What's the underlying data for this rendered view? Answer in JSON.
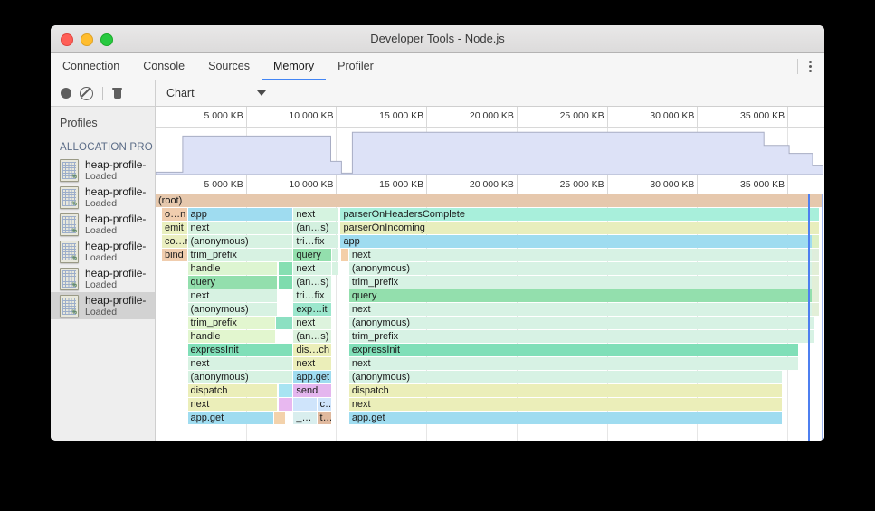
{
  "window": {
    "title": "Developer Tools - Node.js",
    "traffic_lights": [
      "close",
      "minimize",
      "maximize"
    ]
  },
  "tabs": [
    {
      "label": "Connection",
      "active": false
    },
    {
      "label": "Console",
      "active": false
    },
    {
      "label": "Sources",
      "active": false
    },
    {
      "label": "Memory",
      "active": true
    },
    {
      "label": "Profiler",
      "active": false
    }
  ],
  "tabbar": {
    "more_menu": "kebab-menu"
  },
  "toolbar": {
    "record_label": "record",
    "clear_label": "clear",
    "delete_label": "delete",
    "view_select_value": "Chart"
  },
  "sidebar": {
    "title": "Profiles",
    "group_label": "ALLOCATION PRO",
    "items": [
      {
        "name": "heap-profile-",
        "status": "Loaded",
        "selected": false
      },
      {
        "name": "heap-profile-",
        "status": "Loaded",
        "selected": false
      },
      {
        "name": "heap-profile-",
        "status": "Loaded",
        "selected": false
      },
      {
        "name": "heap-profile-",
        "status": "Loaded",
        "selected": false
      },
      {
        "name": "heap-profile-",
        "status": "Loaded",
        "selected": false
      },
      {
        "name": "heap-profile-",
        "status": "Loaded",
        "selected": true
      }
    ]
  },
  "chart_data": {
    "type": "area",
    "title": "",
    "xlabel": "",
    "ylabel": "",
    "tick_labels": [
      "5 000 KB",
      "10 000 KB",
      "15 000 KB",
      "20 000 KB",
      "25 000 KB",
      "30 000 KB",
      "35 000 KB"
    ],
    "tick_values": [
      5000,
      10000,
      15000,
      20000,
      25000,
      30000,
      35000
    ],
    "xlim": [
      0,
      37000
    ],
    "grid": true,
    "overview_series": [
      {
        "x": 0,
        "y": 5
      },
      {
        "x": 1500,
        "y": 5
      },
      {
        "x": 1500,
        "y": 82
      },
      {
        "x": 9700,
        "y": 82
      },
      {
        "x": 9700,
        "y": 28
      },
      {
        "x": 10300,
        "y": 28
      },
      {
        "x": 10300,
        "y": 3
      },
      {
        "x": 10900,
        "y": 3
      },
      {
        "x": 10900,
        "y": 90
      },
      {
        "x": 33700,
        "y": 90
      },
      {
        "x": 33700,
        "y": 62
      },
      {
        "x": 35100,
        "y": 62
      },
      {
        "x": 35100,
        "y": 45
      },
      {
        "x": 36400,
        "y": 45
      },
      {
        "x": 36400,
        "y": 20
      },
      {
        "x": 37000,
        "y": 20
      }
    ]
  },
  "flame_chart": {
    "frames": [
      {
        "label": "(root)",
        "depth": 0,
        "x0": 0,
        "x1": 37000,
        "color": "#e6c8ad"
      },
      {
        "label": "o…n",
        "depth": 1,
        "x0": 350,
        "x1": 1750,
        "color": "#f0cdae"
      },
      {
        "label": "app",
        "depth": 1,
        "x0": 1780,
        "x1": 7560,
        "color": "#9fdcf0"
      },
      {
        "label": "next",
        "depth": 1,
        "x0": 7640,
        "x1": 10100,
        "color": "#d5f3e0"
      },
      {
        "label": "parserOnHeadersComplete",
        "depth": 1,
        "x0": 10250,
        "x1": 36750,
        "color": "#a8efdb"
      },
      {
        "label": "emit",
        "depth": 2,
        "x0": 350,
        "x1": 1750,
        "color": "#eaf0bf"
      },
      {
        "label": "next",
        "depth": 2,
        "x0": 1780,
        "x1": 7560,
        "color": "#d7f2e0"
      },
      {
        "label": "(an…s)",
        "depth": 2,
        "x0": 7640,
        "x1": 10100,
        "color": "#d3f0df"
      },
      {
        "label": "parserOnIncoming",
        "depth": 2,
        "x0": 10250,
        "x1": 36750,
        "color": "#e8eebd"
      },
      {
        "label": "co…r",
        "depth": 3,
        "x0": 350,
        "x1": 1750,
        "color": "#eaeec0"
      },
      {
        "label": "(anonymous)",
        "depth": 3,
        "x0": 1780,
        "x1": 7560,
        "color": "#d7f2e2"
      },
      {
        "label": "tri…fix",
        "depth": 3,
        "x0": 7640,
        "x1": 10100,
        "color": "#d6f1e2"
      },
      {
        "label": "app",
        "depth": 3,
        "x0": 10250,
        "x1": 36600,
        "color": "#9fdcf0"
      },
      {
        "label": "bind",
        "depth": 4,
        "x0": 350,
        "x1": 1750,
        "color": "#f0cdae"
      },
      {
        "label": "trim_prefix",
        "depth": 4,
        "x0": 1780,
        "x1": 7560,
        "color": "#d7f2e2"
      },
      {
        "label": "query",
        "depth": 4,
        "x0": 7640,
        "x1": 9750,
        "color": "#93dfad"
      },
      {
        "label": "",
        "depth": 4,
        "x0": 9800,
        "x1": 10100,
        "color": "#d7f2e2"
      },
      {
        "label": "",
        "depth": 4,
        "x0": 10280,
        "x1": 10680,
        "color": "#f4cfa8"
      },
      {
        "label": "next",
        "depth": 4,
        "x0": 10720,
        "x1": 36500,
        "color": "#d7f2e4"
      },
      {
        "label": "handle",
        "depth": 5,
        "x0": 1780,
        "x1": 6700,
        "color": "#ddf5d1"
      },
      {
        "label": "",
        "depth": 5,
        "x0": 6800,
        "x1": 7560,
        "color": "#86dfb2"
      },
      {
        "label": "next",
        "depth": 5,
        "x0": 7640,
        "x1": 9750,
        "color": "#d7f2e2"
      },
      {
        "label": "",
        "depth": 5,
        "x0": 9800,
        "x1": 10100,
        "color": "#d7f2e2"
      },
      {
        "label": "(anonymous)",
        "depth": 5,
        "x0": 10720,
        "x1": 36500,
        "color": "#d7f2e4"
      },
      {
        "label": "query",
        "depth": 6,
        "x0": 1780,
        "x1": 6700,
        "color": "#93dfad"
      },
      {
        "label": "",
        "depth": 6,
        "x0": 6800,
        "x1": 7560,
        "color": "#7edcae"
      },
      {
        "label": "(an…s)",
        "depth": 6,
        "x0": 7640,
        "x1": 9750,
        "color": "#d7f2e2"
      },
      {
        "label": "trim_prefix",
        "depth": 6,
        "x0": 10720,
        "x1": 36500,
        "color": "#d7f2e4"
      },
      {
        "label": "next",
        "depth": 7,
        "x0": 1780,
        "x1": 6700,
        "color": "#d7f2e2"
      },
      {
        "label": "tri…fix",
        "depth": 7,
        "x0": 7640,
        "x1": 9750,
        "color": "#d7f2e2"
      },
      {
        "label": "query",
        "depth": 7,
        "x0": 10720,
        "x1": 36500,
        "color": "#93dfad"
      },
      {
        "label": "(anonymous)",
        "depth": 8,
        "x0": 1780,
        "x1": 6700,
        "color": "#d7f2e2"
      },
      {
        "label": "exp…it",
        "depth": 8,
        "x0": 7640,
        "x1": 9750,
        "color": "#9ce7cd"
      },
      {
        "label": "next",
        "depth": 8,
        "x0": 10720,
        "x1": 36500,
        "color": "#d7f2e4"
      },
      {
        "label": "trim_prefix",
        "depth": 9,
        "x0": 1780,
        "x1": 6600,
        "color": "#e2f6cf"
      },
      {
        "label": "",
        "depth": 9,
        "x0": 6680,
        "x1": 7560,
        "color": "#8ce0c2"
      },
      {
        "label": "next",
        "depth": 9,
        "x0": 7640,
        "x1": 9750,
        "color": "#ddf3dd"
      },
      {
        "label": "(anonymous)",
        "depth": 9,
        "x0": 10720,
        "x1": 36500,
        "color": "#d7f2e4"
      },
      {
        "label": "handle",
        "depth": 10,
        "x0": 1780,
        "x1": 6600,
        "color": "#e2f6cf"
      },
      {
        "label": "(an…s)",
        "depth": 10,
        "x0": 7640,
        "x1": 9750,
        "color": "#dcf2dd"
      },
      {
        "label": "trim_prefix",
        "depth": 10,
        "x0": 10720,
        "x1": 36500,
        "color": "#d7f2e4"
      },
      {
        "label": "expressInit",
        "depth": 11,
        "x0": 1780,
        "x1": 7560,
        "color": "#80dfb8"
      },
      {
        "label": "dis…ch",
        "depth": 11,
        "x0": 7640,
        "x1": 9750,
        "color": "#ebeeb9"
      },
      {
        "label": "expressInit",
        "depth": 11,
        "x0": 10720,
        "x1": 35600,
        "color": "#80dfb8"
      },
      {
        "label": "next",
        "depth": 12,
        "x0": 1780,
        "x1": 7560,
        "color": "#d7f2e2"
      },
      {
        "label": "next",
        "depth": 12,
        "x0": 7640,
        "x1": 9750,
        "color": "#ebeeb9"
      },
      {
        "label": "next",
        "depth": 12,
        "x0": 10720,
        "x1": 35600,
        "color": "#d7f2e4"
      },
      {
        "label": "(anonymous)",
        "depth": 13,
        "x0": 1780,
        "x1": 7560,
        "color": "#d7f2e2"
      },
      {
        "label": "app.get",
        "depth": 13,
        "x0": 7640,
        "x1": 9750,
        "color": "#9fdcf0"
      },
      {
        "label": "(anonymous)",
        "depth": 13,
        "x0": 10720,
        "x1": 34700,
        "color": "#d7f2e4"
      },
      {
        "label": "dispatch",
        "depth": 14,
        "x0": 1780,
        "x1": 6700,
        "color": "#ebeeb9"
      },
      {
        "label": "",
        "depth": 14,
        "x0": 6800,
        "x1": 7560,
        "color": "#a8e4f2"
      },
      {
        "label": "send",
        "depth": 14,
        "x0": 7640,
        "x1": 9750,
        "color": "#e4b6ee"
      },
      {
        "label": "dispatch",
        "depth": 14,
        "x0": 10720,
        "x1": 34700,
        "color": "#ebeeb9"
      },
      {
        "label": "next",
        "depth": 15,
        "x0": 1780,
        "x1": 6700,
        "color": "#ebeeb9"
      },
      {
        "label": "",
        "depth": 15,
        "x0": 6800,
        "x1": 7560,
        "color": "#e8b8f0"
      },
      {
        "label": "",
        "depth": 15,
        "x0": 7640,
        "x1": 8900,
        "color": "#cfe4fb"
      },
      {
        "label": "c…",
        "depth": 15,
        "x0": 8950,
        "x1": 9750,
        "color": "#cfe4fb"
      },
      {
        "label": "next",
        "depth": 15,
        "x0": 10720,
        "x1": 34700,
        "color": "#ebeeb9"
      },
      {
        "label": "app.get",
        "depth": 16,
        "x0": 1780,
        "x1": 6500,
        "color": "#9fdcf0"
      },
      {
        "label": "",
        "depth": 16,
        "x0": 6550,
        "x1": 7150,
        "color": "#f3d2ab"
      },
      {
        "label": "_…",
        "depth": 16,
        "x0": 7640,
        "x1": 8900,
        "color": "#d9eeee"
      },
      {
        "label": "t…",
        "depth": 16,
        "x0": 8950,
        "x1": 9750,
        "color": "#e0b99e"
      },
      {
        "label": "app.get",
        "depth": 16,
        "x0": 10720,
        "x1": 34700,
        "color": "#9fdcf0"
      }
    ],
    "right_column": [
      {
        "depth": 0,
        "color": "#e6c8ad"
      },
      {
        "depth": 1,
        "color": "#a8efdb"
      },
      {
        "depth": 2,
        "color": "#e8eebd"
      },
      {
        "depth": 3,
        "color": "#dcf0c4"
      },
      {
        "depth": 4,
        "color": "#dfeedc"
      },
      {
        "depth": 5,
        "color": "#e2efd8"
      },
      {
        "depth": 6,
        "color": "#e2efd8"
      },
      {
        "depth": 7,
        "color": "#e2efd8"
      },
      {
        "depth": 8,
        "color": "#e2efd8"
      }
    ]
  }
}
